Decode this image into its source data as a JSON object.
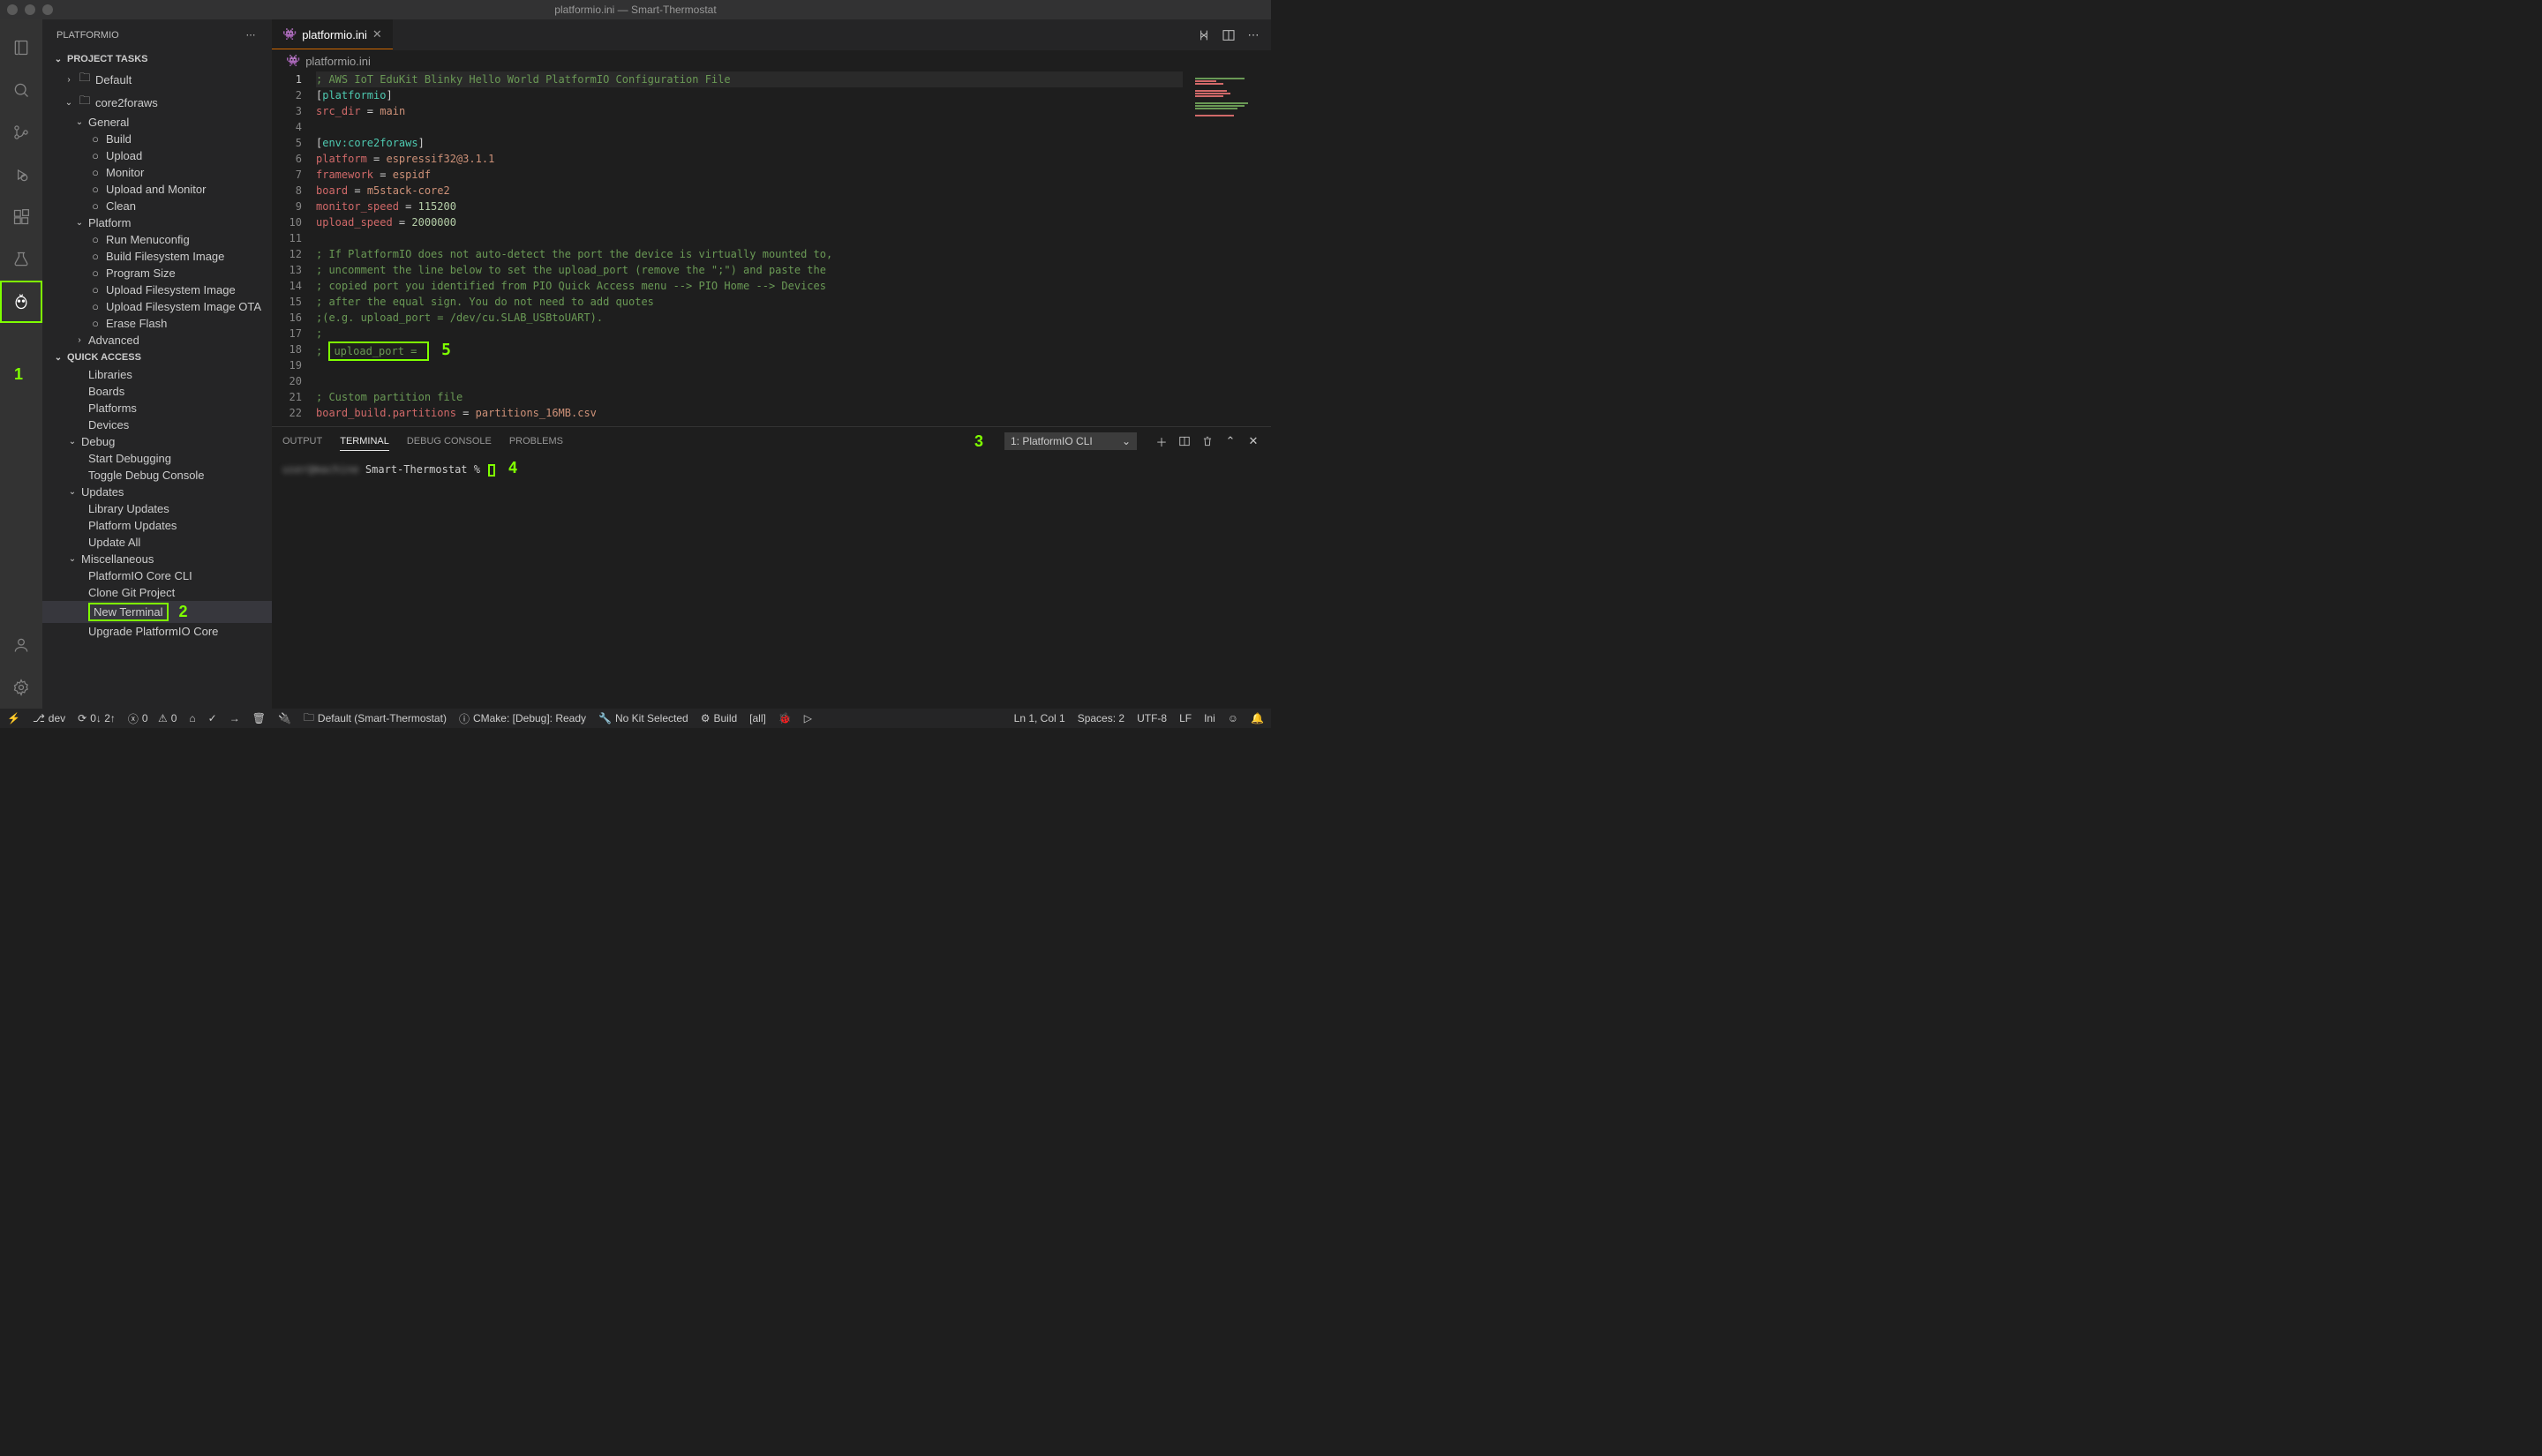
{
  "window": {
    "title": "platformio.ini — Smart-Thermostat"
  },
  "sidebar": {
    "title": "PLATFORMIO",
    "sections": {
      "project_tasks": "PROJECT TASKS",
      "quick_access": "QUICK ACCESS"
    },
    "tree": {
      "default": "Default",
      "core2foraws": "core2foraws",
      "general": "General",
      "build": "Build",
      "upload": "Upload",
      "monitor": "Monitor",
      "upload_monitor": "Upload and Monitor",
      "clean": "Clean",
      "platform": "Platform",
      "run_menuconfig": "Run Menuconfig",
      "build_fs": "Build Filesystem Image",
      "program_size": "Program Size",
      "upload_fs": "Upload Filesystem Image",
      "upload_fs_ota": "Upload Filesystem Image OTA",
      "erase_flash": "Erase Flash",
      "advanced": "Advanced",
      "libraries": "Libraries",
      "boards": "Boards",
      "platforms": "Platforms",
      "devices": "Devices",
      "debug": "Debug",
      "start_debug": "Start Debugging",
      "toggle_debug": "Toggle Debug Console",
      "updates": "Updates",
      "lib_updates": "Library Updates",
      "plat_updates": "Platform Updates",
      "update_all": "Update All",
      "misc": "Miscellaneous",
      "pio_core_cli": "PlatformIO Core CLI",
      "clone_git": "Clone Git Project",
      "new_terminal": "New Terminal",
      "upgrade_core": "Upgrade PlatformIO Core"
    }
  },
  "tab": {
    "name": "platformio.ini"
  },
  "breadcrumb": {
    "file": "platformio.ini"
  },
  "annotations": {
    "n1": "1",
    "n2": "2",
    "n3": "3",
    "n4": "4",
    "n5": "5"
  },
  "code": {
    "l1": "; AWS IoT EduKit Blinky Hello World PlatformIO Configuration File",
    "l2a": "[",
    "l2b": "platformio",
    "l2c": "]",
    "l3a": "src_dir",
    "l3b": " = ",
    "l3c": "main",
    "l5a": "[",
    "l5b": "env:core2foraws",
    "l5c": "]",
    "l6a": "platform",
    "l6b": " = ",
    "l6c": "espressif32@3.1.1",
    "l7a": "framework",
    "l7b": " = ",
    "l7c": "espidf",
    "l8a": "board",
    "l8b": " = ",
    "l8c": "m5stack-core2",
    "l9a": "monitor_speed",
    "l9b": " = ",
    "l9c": "115200",
    "l10a": "upload_speed",
    "l10b": " = ",
    "l10c": "2000000",
    "l12": "; If PlatformIO does not auto-detect the port the device is virtually mounted to,",
    "l13": "; uncomment the line below to set the upload_port (remove the \";\") and paste the ",
    "l14": "; copied port you identified from PIO Quick Access menu --> PIO Home --> Devices",
    "l15": "; after the equal sign. You do not need to add quotes",
    "l16": ";(e.g. upload_port = /dev/cu.SLAB_USBtoUART).",
    "l17": ";",
    "l18a": "; ",
    "l18b": "upload_port = ",
    "l21": "; Custom partition file",
    "l22a": "board_build.partitions",
    "l22b": " = ",
    "l22c": "partitions_16MB.csv"
  },
  "panel": {
    "tabs": {
      "output": "OUTPUT",
      "terminal": "TERMINAL",
      "debug": "DEBUG CONSOLE",
      "problems": "PROBLEMS"
    },
    "select": "1: PlatformIO CLI",
    "prompt_blur": "user@machine",
    "prompt": " Smart-Thermostat % "
  },
  "status": {
    "branch": "dev",
    "sync": "0↓ 2↑",
    "errors": "0",
    "warnings": "0",
    "default_env": "Default (Smart-Thermostat)",
    "cmake": "CMake: [Debug]: Ready",
    "no_kit": "No Kit Selected",
    "build": "Build",
    "all": "[all]",
    "lncol": "Ln 1, Col 1",
    "spaces": "Spaces: 2",
    "enc": "UTF-8",
    "eol": "LF",
    "lang": "Ini"
  }
}
